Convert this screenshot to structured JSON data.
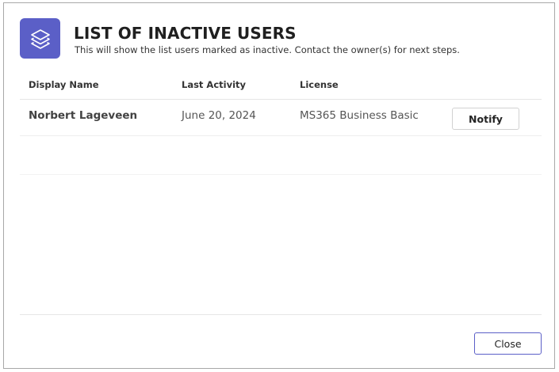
{
  "header": {
    "icon": "layers-icon",
    "accent_color": "#5b5fc7",
    "title": "LIST OF INACTIVE USERS",
    "subtitle": "This will show the list users marked as inactive. Contact the owner(s) for next steps."
  },
  "table": {
    "columns": [
      "Display Name",
      "Last Activity",
      "License"
    ],
    "rows": [
      {
        "display_name": "Norbert Lageveen",
        "last_activity": "June 20, 2024",
        "license": "MS365 Business Basic",
        "action_label": "Notify"
      }
    ]
  },
  "footer": {
    "close_label": "Close"
  }
}
